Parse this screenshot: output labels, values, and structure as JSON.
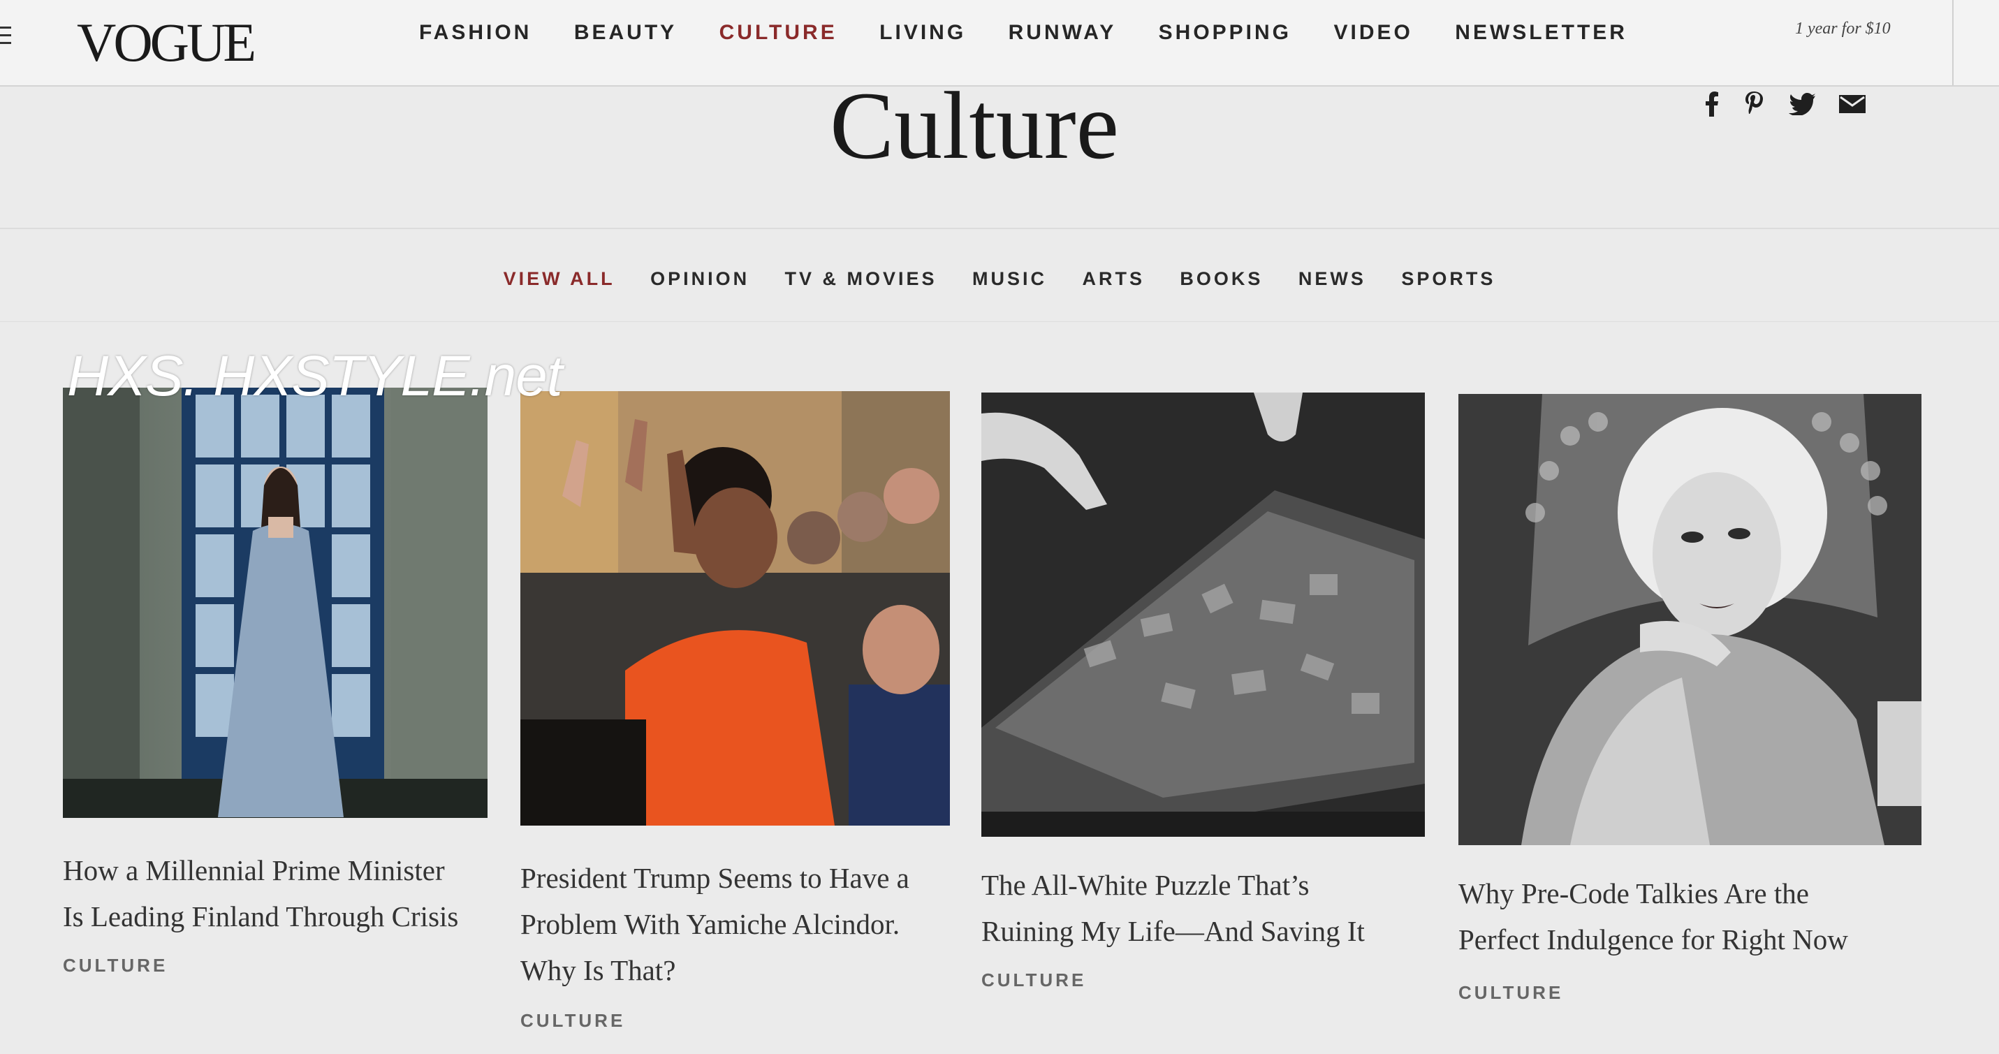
{
  "header": {
    "logo": "VOGUE",
    "nav": [
      "FASHION",
      "BEAUTY",
      "CULTURE",
      "LIVING",
      "RUNWAY",
      "SHOPPING",
      "VIDEO",
      "NEWSLETTER"
    ],
    "active_nav": "CULTURE",
    "promo": "1 year for $10"
  },
  "section": {
    "title": "Culture",
    "social_icons": [
      "facebook-icon",
      "pinterest-icon",
      "twitter-icon",
      "email-icon"
    ]
  },
  "subnav": {
    "items": [
      "VIEW ALL",
      "OPINION",
      "TV & MOVIES",
      "MUSIC",
      "ARTS",
      "BOOKS",
      "NEWS",
      "SPORTS"
    ],
    "active": "VIEW ALL"
  },
  "watermark": "HXS. HXSTYLE.net",
  "articles": [
    {
      "headline_lines": [
        "How a Millennial Prime Minister",
        "Is Leading Finland Through Crisis"
      ],
      "rubric": "CULTURE"
    },
    {
      "headline_lines": [
        "President Trump Seems to Have a",
        "Problem With Yamiche Alcindor.",
        "Why Is That?"
      ],
      "rubric": "CULTURE"
    },
    {
      "headline_lines": [
        "The All-White Puzzle That’s",
        "Ruining My Life—And Saving It"
      ],
      "rubric": "CULTURE"
    },
    {
      "headline_lines": [
        "Why Pre-Code Talkies Are the",
        "Perfect Indulgence for Right Now"
      ],
      "rubric": "CULTURE"
    }
  ],
  "colors": {
    "accent": "#8a2a2a",
    "text": "#1f1f1f",
    "background": "#ebebeb"
  }
}
